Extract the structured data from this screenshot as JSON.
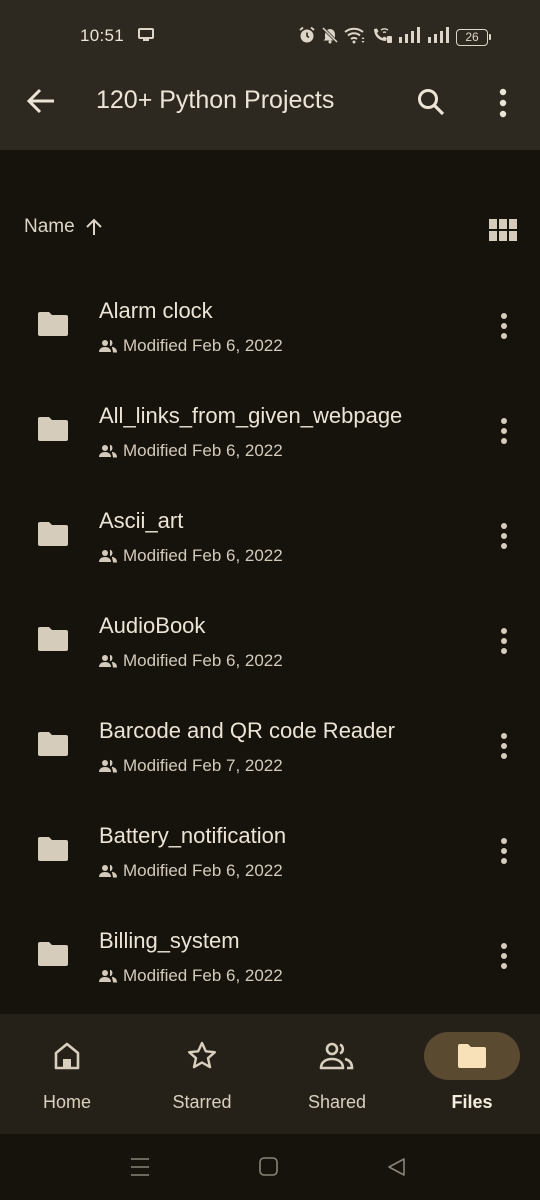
{
  "status_bar": {
    "time": "10:51",
    "battery_level": "26",
    "icons": [
      "screen-cast-icon",
      "alarm-icon",
      "mute-bell-icon",
      "wifi-icon",
      "wifi-calling-icon",
      "signal-icon",
      "signal-icon"
    ]
  },
  "app_bar": {
    "title": "120+ Python Projects",
    "back_icon": "arrow-left-icon",
    "search_icon": "search-icon",
    "more_icon": "more-vert-icon"
  },
  "sort_bar": {
    "label": "Name",
    "direction_icon": "arrow-up-icon",
    "view_toggle_icon": "grid-view-icon"
  },
  "files": [
    {
      "name": "Alarm clock",
      "meta": "Modified Feb 6, 2022",
      "shared": true
    },
    {
      "name": "All_links_from_given_webpage",
      "meta": "Modified Feb 6, 2022",
      "shared": true
    },
    {
      "name": "Ascii_art",
      "meta": "Modified Feb 6, 2022",
      "shared": true
    },
    {
      "name": "AudioBook",
      "meta": "Modified Feb 6, 2022",
      "shared": true
    },
    {
      "name": "Barcode and QR code Reader",
      "meta": "Modified Feb 7, 2022",
      "shared": true
    },
    {
      "name": "Battery_notification",
      "meta": "Modified Feb 6, 2022",
      "shared": true
    },
    {
      "name": "Billing_system",
      "meta": "Modified Feb 6, 2022",
      "shared": true
    }
  ],
  "bottom_nav": {
    "items": [
      {
        "label": "Home",
        "icon": "home-icon",
        "active": false
      },
      {
        "label": "Starred",
        "icon": "star-icon",
        "active": false
      },
      {
        "label": "Shared",
        "icon": "people-icon",
        "active": false
      },
      {
        "label": "Files",
        "icon": "folder-icon",
        "active": true
      }
    ]
  },
  "system_nav": [
    "recents-icon",
    "home-icon",
    "back-icon"
  ],
  "colors": {
    "app_bar_bg": "#2e2920",
    "content_bg": "#16130c",
    "bottom_nav_bg": "#262118",
    "active_pill": "#5a4a30",
    "folder": "#d6ccbc",
    "active_folder": "#f8e0b8",
    "text": "#ece4d6"
  }
}
